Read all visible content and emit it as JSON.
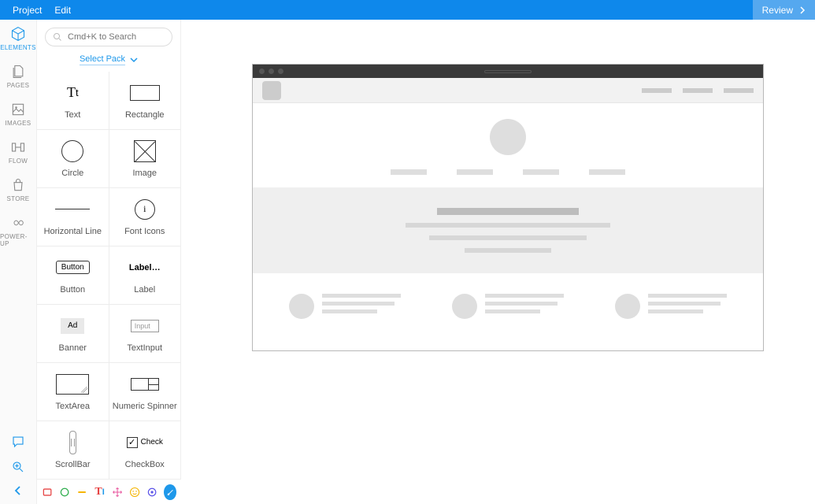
{
  "menubar": {
    "project": "Project",
    "edit": "Edit",
    "review": "Review"
  },
  "rail": [
    {
      "id": "elements",
      "label": "ELEMENTS"
    },
    {
      "id": "pages",
      "label": "PAGES"
    },
    {
      "id": "images",
      "label": "IMAGES"
    },
    {
      "id": "flow",
      "label": "FLOW"
    },
    {
      "id": "store",
      "label": "STORE"
    },
    {
      "id": "powerup",
      "label": "POWER-UP"
    }
  ],
  "search": {
    "placeholder": "Cmd+K to Search"
  },
  "select_pack": "Select Pack",
  "elements": [
    {
      "a": "Text",
      "b": "Rectangle"
    },
    {
      "a": "Circle",
      "b": "Image"
    },
    {
      "a": "Horizontal Line",
      "b": "Font Icons"
    },
    {
      "a": "Button",
      "b": "Label"
    },
    {
      "a": "Banner",
      "b": "TextInput"
    },
    {
      "a": "TextArea",
      "b": "Numeric Spinner"
    },
    {
      "a": "ScrollBar",
      "b": "CheckBox"
    }
  ],
  "shapes": {
    "button": "Button",
    "label": "Label…",
    "ad": "Ad",
    "input": "Input",
    "check": "Check",
    "ficn": "i"
  }
}
